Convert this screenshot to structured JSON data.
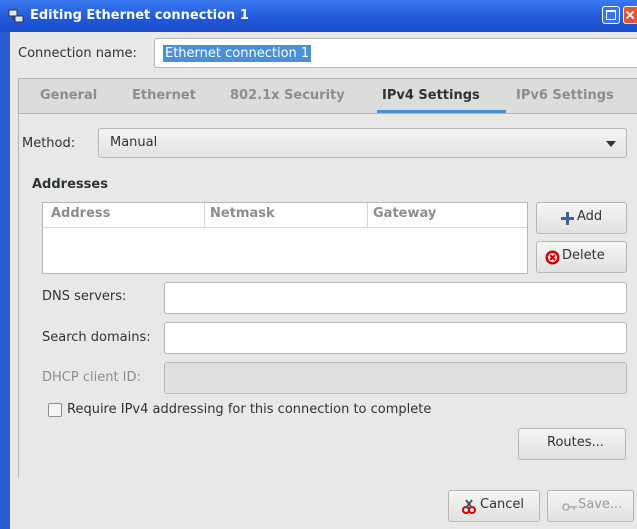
{
  "window": {
    "title": "Editing Ethernet connection 1"
  },
  "connection": {
    "label": "Connection name:",
    "value": "Ethernet connection 1"
  },
  "tabs": [
    {
      "label": "General",
      "active": false
    },
    {
      "label": "Ethernet",
      "active": false
    },
    {
      "label": "802.1x Security",
      "active": false
    },
    {
      "label": "IPv4 Settings",
      "active": true
    },
    {
      "label": "IPv6 Settings",
      "active": false
    }
  ],
  "ipv4": {
    "method_label": "Method:",
    "method_value": "Manual",
    "addresses_heading": "Addresses",
    "columns": [
      "Address",
      "Netmask",
      "Gateway"
    ],
    "add_label": "Add",
    "delete_label": "Delete",
    "dns_label": "DNS servers:",
    "search_label": "Search domains:",
    "dhcp_label": "DHCP client ID:",
    "require_label": "Require IPv4 addressing for this connection to complete",
    "routes_label": "Routes..."
  },
  "footer": {
    "cancel_label": "Cancel",
    "save_label": "Save..."
  },
  "colors": {
    "accent": "#4a90d9",
    "titlebar": "#1f57d8",
    "background": "#e8e8e7"
  },
  "icons": [
    "network-icon",
    "maximize-icon",
    "close-icon",
    "plus-icon",
    "delete-icon",
    "cancel-icon",
    "save-icon"
  ]
}
